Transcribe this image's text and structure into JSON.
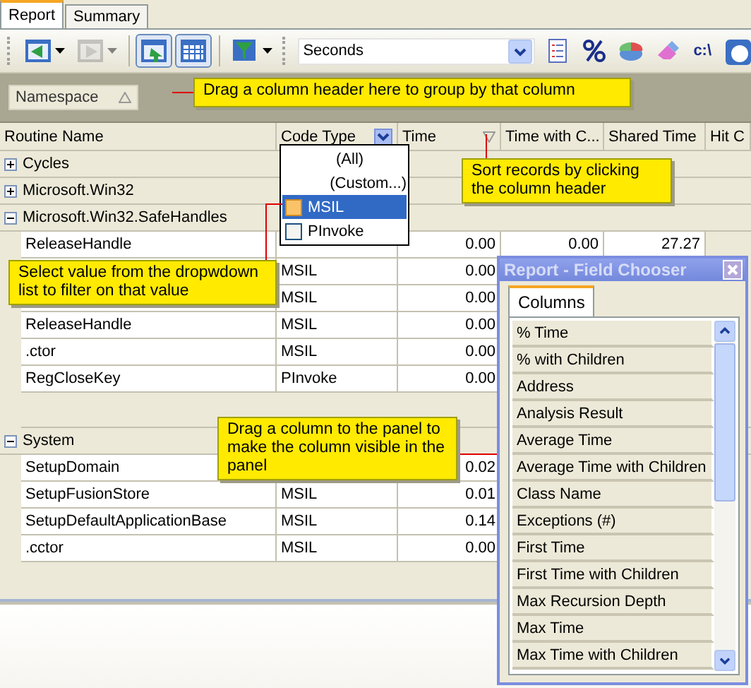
{
  "tabs": [
    {
      "label": "Report",
      "selected": true
    },
    {
      "label": "Summary",
      "selected": false
    }
  ],
  "toolbar": {
    "buttons": [
      {
        "disabled": false,
        "pressed": false,
        "has_menu": true
      },
      {
        "disabled": true,
        "pressed": false,
        "has_menu": true
      },
      {
        "disabled": false,
        "pressed": true,
        "has_menu": false
      },
      {
        "disabled": false,
        "pressed": true,
        "has_menu": false
      },
      {
        "disabled": false,
        "pressed": false,
        "has_menu": true
      }
    ],
    "units_combo": {
      "value": "Seconds"
    },
    "path_button": {
      "label": "c:\\"
    }
  },
  "group_panel": {
    "grouped_column": {
      "label": "Namespace"
    }
  },
  "table": {
    "columns": [
      {
        "label": "Routine Name"
      },
      {
        "label": "Code Type",
        "filter": true
      },
      {
        "label": "Time",
        "sort": true
      },
      {
        "label": "Time with C..."
      },
      {
        "label": "Shared Time"
      },
      {
        "label": "Hit C"
      }
    ],
    "groups": [
      {
        "label": "Cycles",
        "expanded": false
      },
      {
        "label": "Microsoft.Win32",
        "expanded": false
      },
      {
        "label": "Microsoft.Win32.SafeHandles",
        "expanded": true,
        "children": [
          {
            "name": "ReleaseHandle",
            "time": "0.00",
            "time_with_children": "0.00",
            "shared_time": "27.27"
          },
          {
            "code_type": "MSIL",
            "time": "0.00"
          },
          {
            "code_type": "MSIL",
            "time": "0.00"
          },
          {
            "name": "ReleaseHandle",
            "code_type": "MSIL",
            "time": "0.00"
          },
          {
            "name": ".ctor",
            "code_type": "MSIL",
            "time": "0.00"
          },
          {
            "name": "RegCloseKey",
            "code_type": "PInvoke",
            "time": "0.00"
          }
        ]
      },
      {
        "label": "System",
        "expanded": true,
        "children": [
          {
            "name": "SetupDomain",
            "time": "0.02"
          },
          {
            "name": "SetupFusionStore",
            "code_type": "MSIL",
            "time": "0.01"
          },
          {
            "name": "SetupDefaultApplicationBase",
            "code_type": "MSIL",
            "time": "0.14"
          },
          {
            "name": ".cctor",
            "code_type": "MSIL",
            "time": "0.00"
          }
        ]
      }
    ]
  },
  "filter_dropdown": {
    "items": [
      {
        "label": "(All)",
        "kind": "plain",
        "selected": false
      },
      {
        "label": "(Custom...)",
        "kind": "plain",
        "selected": false
      },
      {
        "label": "MSIL",
        "kind": "check",
        "selected": true
      },
      {
        "label": "PInvoke",
        "kind": "check",
        "selected": false
      }
    ]
  },
  "callouts": [
    {
      "text": "Drag a column header here to group by that column"
    },
    {
      "text": "Sort records by clicking the column header"
    },
    {
      "text": "Select value from the dropwdown list to filter on that value"
    },
    {
      "text": "Drag a column to the panel to make the column visible in the panel"
    }
  ],
  "field_chooser": {
    "title": "Report - Field Chooser",
    "tabs": [
      {
        "label": "Columns",
        "selected": true
      }
    ],
    "fields": [
      "% Time",
      "% with Children",
      "Address",
      "Analysis Result",
      "Average Time",
      "Average Time with Children",
      "Class Name",
      "Exceptions (#)",
      "First Time",
      "First Time with Children",
      "Max Recursion Depth",
      "Max Time",
      "Max Time with Children"
    ]
  }
}
